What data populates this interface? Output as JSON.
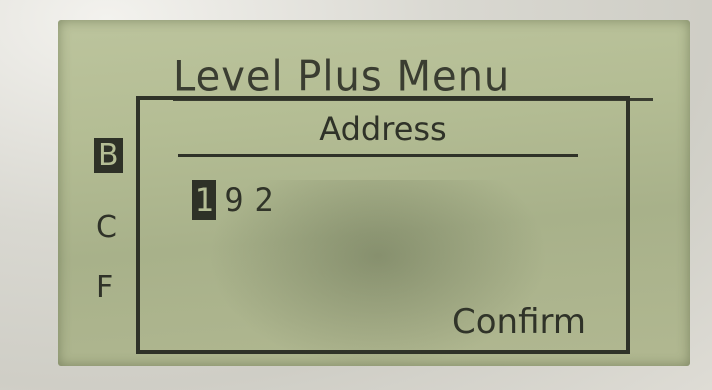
{
  "background_menu": {
    "title": "Level Plus Menu",
    "items": [
      "B",
      "C",
      "F"
    ],
    "selected_index": 0
  },
  "dialog": {
    "title": "Address",
    "digits": [
      "1",
      "9",
      "2"
    ],
    "active_digit_index": 0,
    "confirm_label": "Confirm"
  },
  "colors": {
    "lcd_background": "#b4bd94",
    "lcd_pixel": "#2f3228"
  }
}
